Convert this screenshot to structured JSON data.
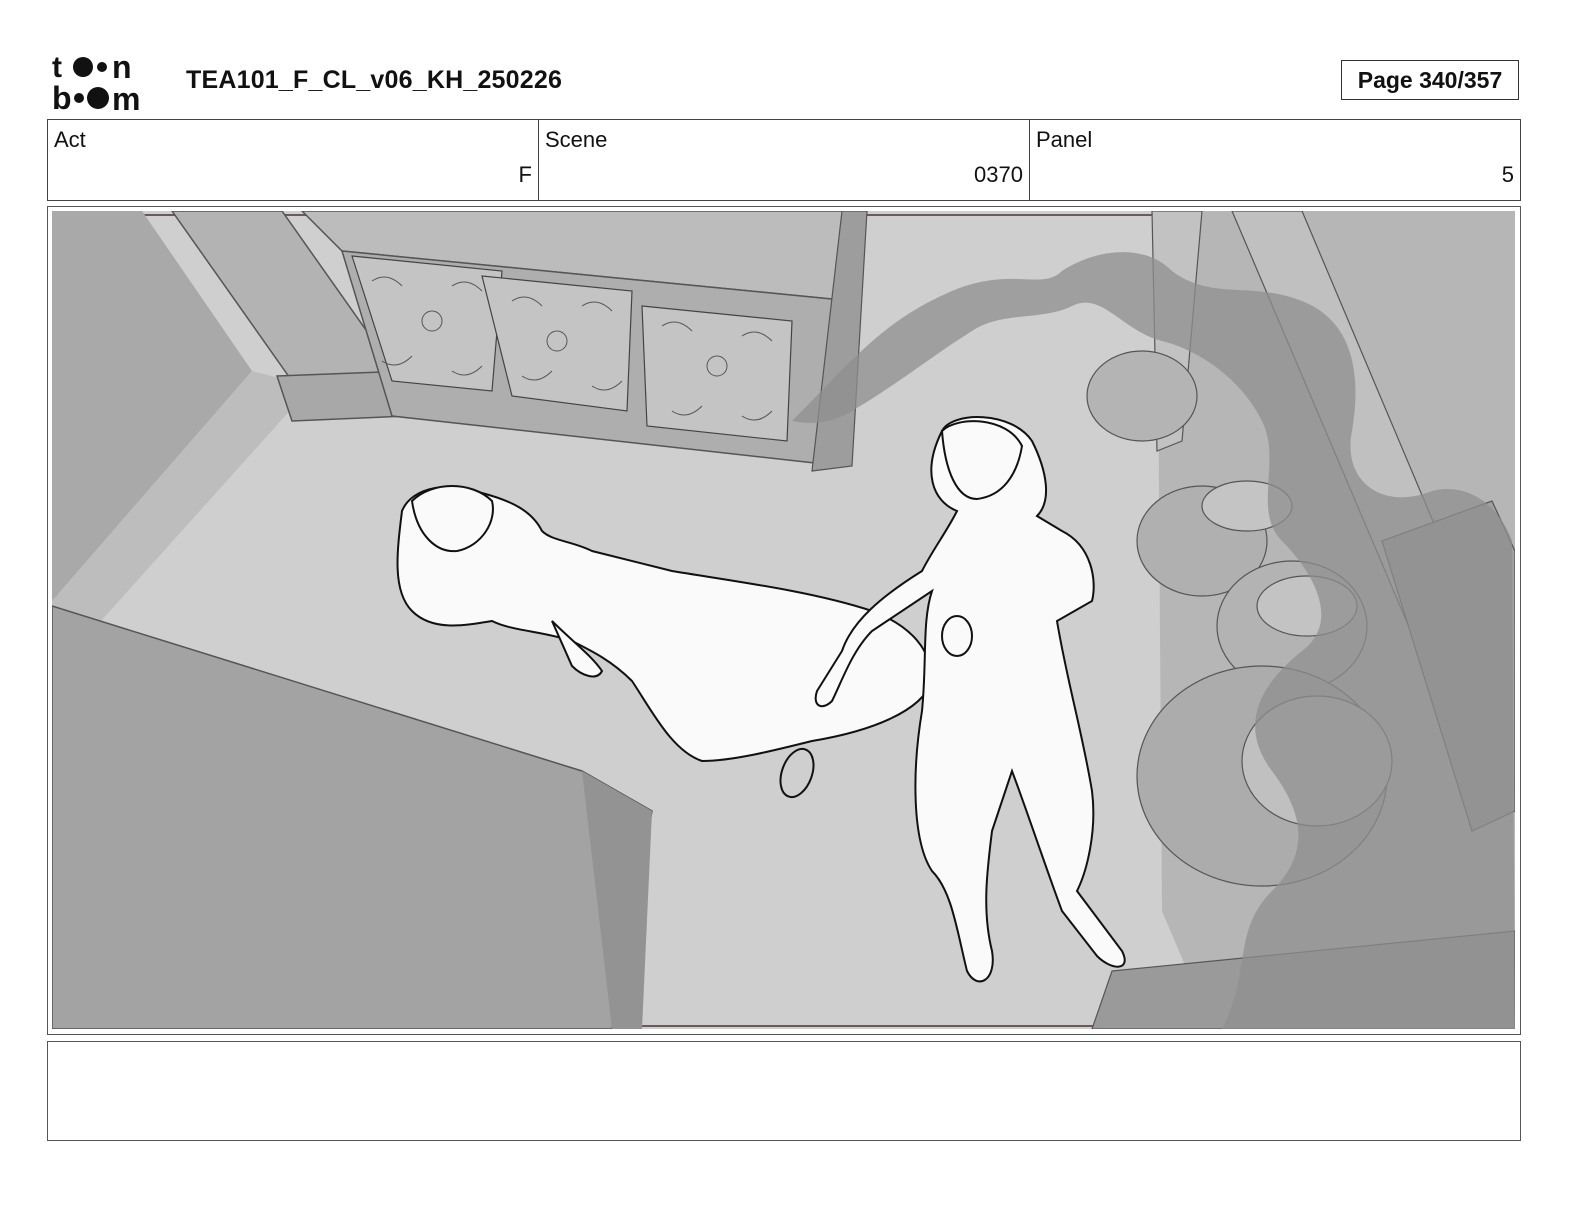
{
  "header": {
    "logo_text": "toon boom",
    "document_title": "TEA101_F_CL_v06_KH_250226",
    "page_indicator": "Page 340/357"
  },
  "info": {
    "act_label": "Act",
    "act_value": "F",
    "scene_label": "Scene",
    "scene_value": "0370",
    "panel_label": "Panel",
    "panel_value": "5"
  },
  "notes": {
    "text": ""
  },
  "colors": {
    "background_gray": "#c9c9c9",
    "dark_gray": "#9a9a9a",
    "floor_gray": "#cfcfcf",
    "smoke_gray": "#8c8c8c",
    "line": "#111111"
  }
}
